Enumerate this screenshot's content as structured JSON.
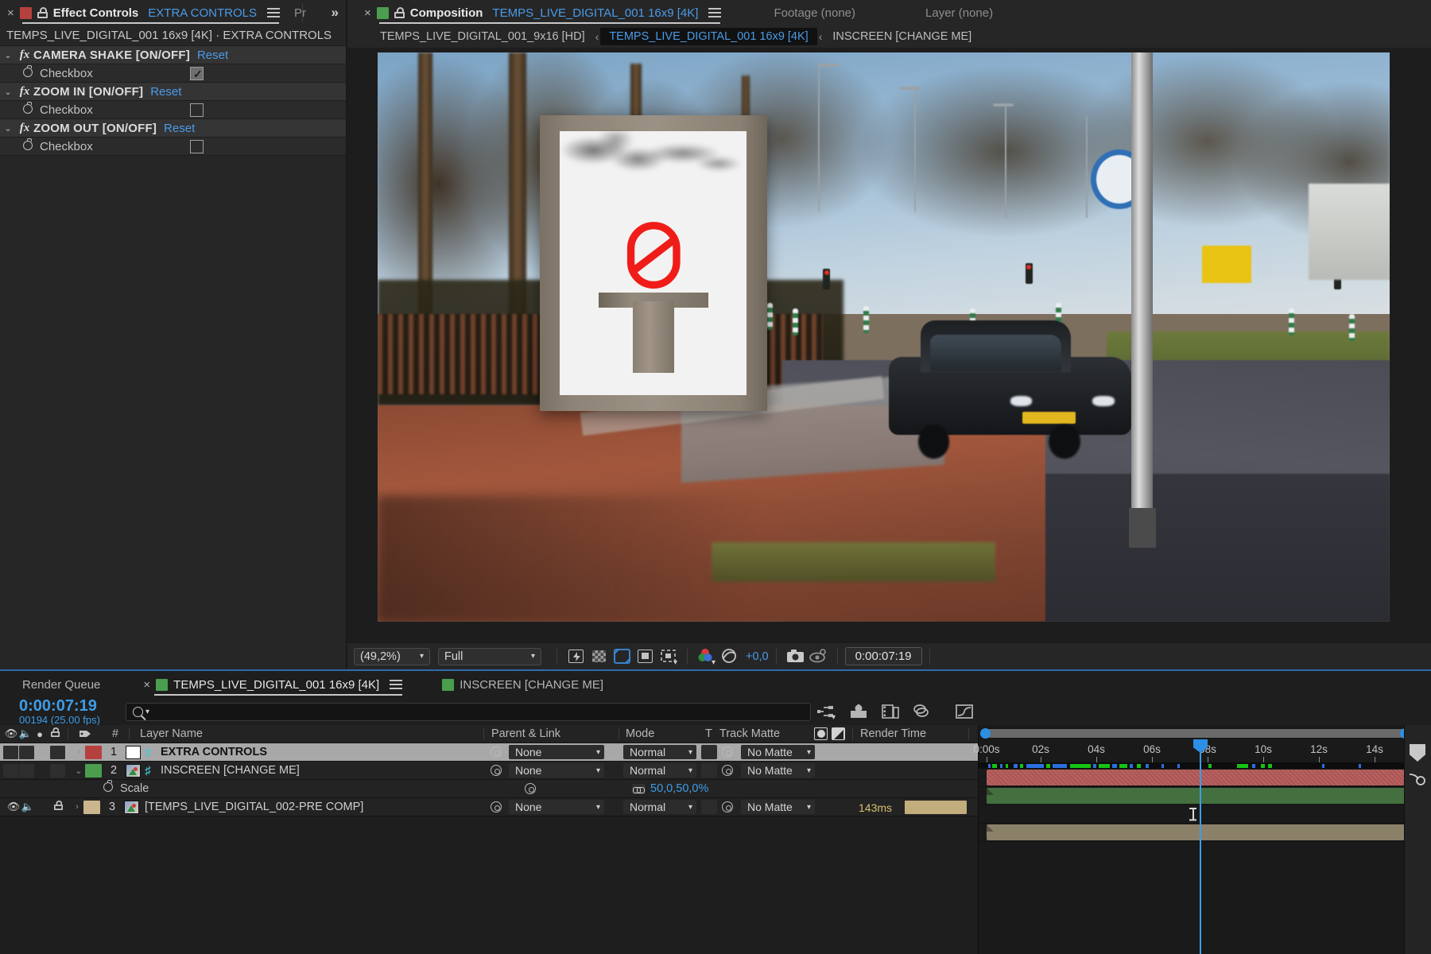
{
  "effect_controls": {
    "tab": {
      "close": "×",
      "title": "Effect Controls",
      "subject": "EXTRA CONTROLS",
      "menu_icon": "hamburger-icon",
      "lock_icon": "lock-icon",
      "swatch_color": "#b5413e",
      "next_tab_label": "Pr",
      "overflow": "»"
    },
    "header": "TEMPS_LIVE_DIGITAL_001 16x9 [4K] · EXTRA CONTROLS",
    "effects": [
      {
        "name": "CAMERA SHAKE [ON/OFF]",
        "reset": "Reset",
        "twirl": "⌄",
        "fx": "fx",
        "property": {
          "label": "Checkbox",
          "checked": true
        }
      },
      {
        "name": "ZOOM IN [ON/OFF]",
        "reset": "Reset",
        "twirl": "⌄",
        "fx": "fx",
        "property": {
          "label": "Checkbox",
          "checked": false
        }
      },
      {
        "name": "ZOOM OUT [ON/OFF]",
        "reset": "Reset",
        "twirl": "⌄",
        "fx": "fx",
        "property": {
          "label": "Checkbox",
          "checked": false
        }
      }
    ]
  },
  "composition": {
    "overflow": "»",
    "tab": {
      "close": "×",
      "title": "Composition",
      "subject": "TEMPS_LIVE_DIGITAL_001 16x9 [4K]",
      "menu_icon": "hamburger-icon",
      "lock_icon": "lock-icon",
      "swatch_color": "#4a9e4e"
    },
    "other_tabs": [
      "Footage (none)",
      "Layer (none)"
    ],
    "subtabs": [
      {
        "label": "TEMPS_LIVE_DIGITAL_001_9x16 [HD]",
        "active": false
      },
      {
        "label": "TEMPS_LIVE_DIGITAL_001 16x9 [4K]",
        "active": true
      },
      {
        "label": "INSCREEN [CHANGE ME]",
        "active": false
      }
    ],
    "subtab_arrow": "‹",
    "toolbar": {
      "zoom": "(49,2%)",
      "resolution": "Full",
      "icons": [
        "fast-previews-icon",
        "transparency-grid-icon",
        "title-action-safe-icon",
        "mask-shape-icon",
        "region-of-interest-icon",
        "channels-icon",
        "exposure-reset-icon",
        "snapshot-icon",
        "show-snapshot-icon"
      ],
      "exposure": "+0,0",
      "timecode": "0:00:07:19"
    }
  },
  "timeline": {
    "tabs": [
      {
        "label": "Render Queue",
        "active": false,
        "has_close": false,
        "swatch": null
      },
      {
        "label": "TEMPS_LIVE_DIGITAL_001 16x9 [4K]",
        "active": true,
        "has_close": true,
        "swatch": "#4a9e4e"
      },
      {
        "label": "INSCREEN [CHANGE ME]",
        "active": false,
        "has_close": false,
        "swatch": "#4a9e4e"
      }
    ],
    "close": "×",
    "menu_icon": "hamburger-icon",
    "current_time": "0:00:07:19",
    "current_frame": "00194 (25.00 fps)",
    "search_placeholder": "",
    "toolbar_icons": [
      "composition-mini-flowchart-icon",
      "draft-3d-icon",
      "hide-shy-layers-icon",
      "frame-blending-icon",
      "graph-editor-icon"
    ],
    "columns": {
      "eye": "video-icon",
      "audio": "audio-icon",
      "solo": "solo-icon",
      "lock": "lock-icon",
      "tag": "label-icon",
      "number": "#",
      "layer_name": "Layer Name",
      "parent": "Parent & Link",
      "mode": "Mode",
      "t": "T",
      "track_matte": "Track Matte",
      "render_time": "Render Time"
    },
    "layers": [
      {
        "num": "1",
        "name": "EXTRA CONTROLS",
        "color": "#b5413e",
        "selected": true,
        "eye": false,
        "audio": false,
        "lock": false,
        "twirl": "›",
        "parent": "None",
        "mode": "Normal",
        "matte": "No Matte",
        "render_time": "",
        "bar_color": "red",
        "source_type": "solid"
      },
      {
        "num": "2",
        "name": "INSCREEN [CHANGE ME]",
        "color": "#4a9e4e",
        "selected": false,
        "eye": false,
        "audio": false,
        "lock": false,
        "twirl": "⌄",
        "parent": "None",
        "mode": "Normal",
        "matte": "No Matte",
        "render_time": "",
        "bar_color": "green",
        "source_type": "comp"
      },
      {
        "num": "3",
        "name": "[TEMPS_LIVE_DIGITAL_002-PRE COMP]",
        "color": "#cbb68e",
        "selected": false,
        "eye": true,
        "audio": true,
        "lock": true,
        "twirl": "›",
        "parent": "None",
        "mode": "Normal",
        "matte": "No Matte",
        "render_time": "143ms",
        "bar_color": "tan",
        "source_type": "comp"
      }
    ],
    "property_row": {
      "label": "Scale",
      "value": "50,0,50,0%",
      "link_icon": "link-icon"
    },
    "ruler": {
      "labels": [
        "0:00s",
        "02s",
        "04s",
        "06s",
        "08s",
        "10s",
        "12s",
        "14s"
      ],
      "playhead_time": "08s"
    }
  },
  "colors": {
    "accent_blue": "#3e9de8",
    "link_blue": "#4a9be8",
    "panel_bg": "#262626",
    "timeline_bg": "#1e1e1e",
    "selection": "#a8a8a8"
  }
}
